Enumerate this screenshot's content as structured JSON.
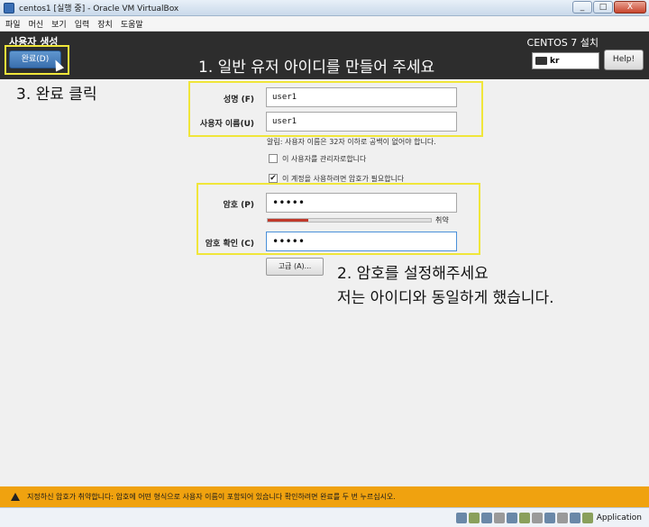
{
  "window": {
    "title": "centos1 [실행 중] - Oracle VM VirtualBox",
    "buttons": {
      "minimize": "_",
      "maximize": "□",
      "close": "X"
    }
  },
  "menubar": {
    "items": [
      "파일",
      "머신",
      "보기",
      "입력",
      "장치",
      "도움말"
    ]
  },
  "header": {
    "page_title": "사용자 생성",
    "done_label": "완료(D)",
    "product_title": "CENTOS 7 설치",
    "keyboard_layout": "kr",
    "help_label": "Help!"
  },
  "annotations": {
    "step1": "1. 일반 유저 아이디를 만들어 주세요",
    "step3": "3. 완료 클릭",
    "step2_line1": "2. 암호를 설정해주세요",
    "step2_line2": "저는 아이디와 동일하게 했습니다."
  },
  "form": {
    "fullname_label": "성명 (F)",
    "fullname_value": "user1",
    "username_label": "사용자 이름(U)",
    "username_value": "user1",
    "hint": "알림: 사용자 이름은 32자 이하로 공백이 없어야 합니다.",
    "admin_checkbox": {
      "label": "이 사용자를 관리자로합니다",
      "checked": false
    },
    "password_required_checkbox": {
      "label": "이 계정을 사용하려면 암호가 필요합니다",
      "checked": true
    },
    "password_label": "암호 (P)",
    "password_value": "•••••",
    "confirm_label": "암호 확인 (C)",
    "confirm_value": "•••••",
    "strength_label": "취약",
    "strength_level": 0.25,
    "advanced_label": "고급 (A)..."
  },
  "warning": {
    "text": "지정하신 암호가 취약합니다: 암호에 어떤 형식으로 사용자 이름이 포함되어 있습니다  확인하려면 완료를 두 번 누르십시오."
  },
  "statusbar": {
    "host_key_label": "Application"
  },
  "colors": {
    "header_bg": "#2d2d2d",
    "done_btn": "#3a6fae",
    "highlight": "#f0e63a",
    "warning_bg": "#f0a20f",
    "strength_fill": "#c0392b"
  }
}
